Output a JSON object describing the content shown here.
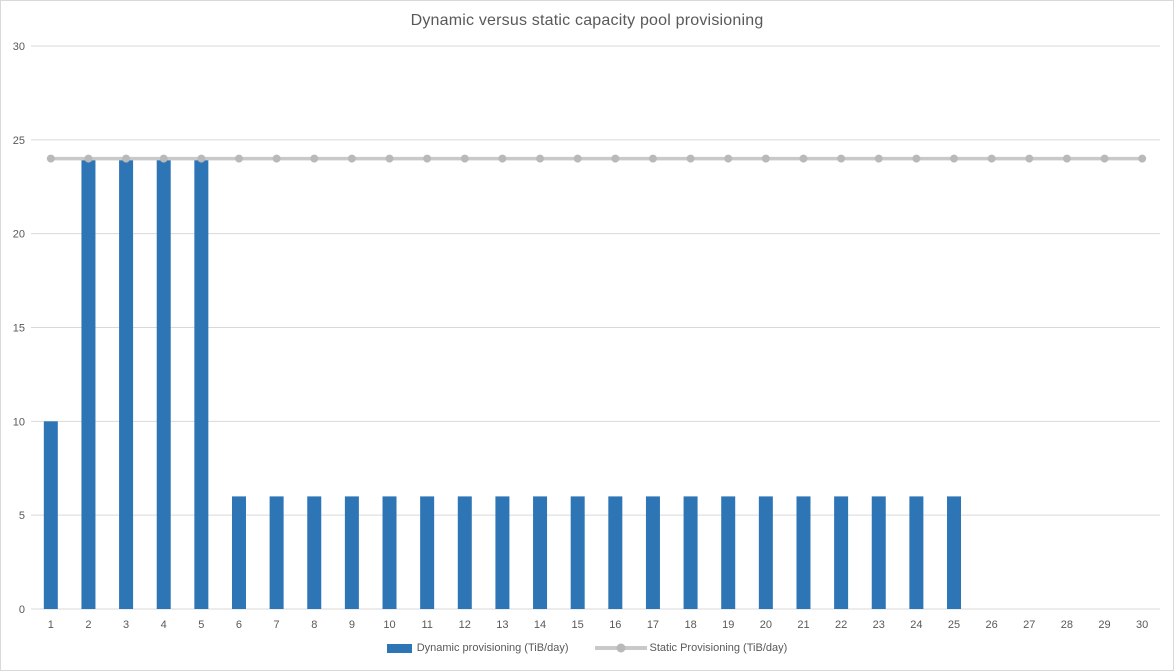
{
  "chart_data": {
    "type": "bar",
    "title": "Dynamic versus static capacity pool provisioning",
    "categories": [
      1,
      2,
      3,
      4,
      5,
      6,
      7,
      8,
      9,
      10,
      11,
      12,
      13,
      14,
      15,
      16,
      17,
      18,
      19,
      20,
      21,
      22,
      23,
      24,
      25,
      26,
      27,
      28,
      29,
      30
    ],
    "series": [
      {
        "name": "Dynamic provisioning (TiB/day)",
        "type": "bar",
        "color": "#2E75B6",
        "values": [
          10,
          24,
          24,
          24,
          24,
          6,
          6,
          6,
          6,
          6,
          6,
          6,
          6,
          6,
          6,
          6,
          6,
          6,
          6,
          6,
          6,
          6,
          6,
          6,
          6,
          0,
          0,
          0,
          0,
          0
        ]
      },
      {
        "name": "Static Provisioning (TiB/day)",
        "type": "line",
        "color": "#C9C9C9",
        "marker_color": "#B9B9B9",
        "values": [
          24,
          24,
          24,
          24,
          24,
          24,
          24,
          24,
          24,
          24,
          24,
          24,
          24,
          24,
          24,
          24,
          24,
          24,
          24,
          24,
          24,
          24,
          24,
          24,
          24,
          24,
          24,
          24,
          24,
          24
        ]
      }
    ],
    "xlabel": "",
    "ylabel": "",
    "ylim": [
      0,
      30
    ],
    "yticks": [
      0,
      5,
      10,
      15,
      20,
      25,
      30
    ],
    "grid": true,
    "legend_position": "bottom",
    "text_color": "#595959",
    "gridline_color": "#D9D9D9",
    "background_color": "#FFFFFF",
    "border_color": "#D9D9D9"
  }
}
